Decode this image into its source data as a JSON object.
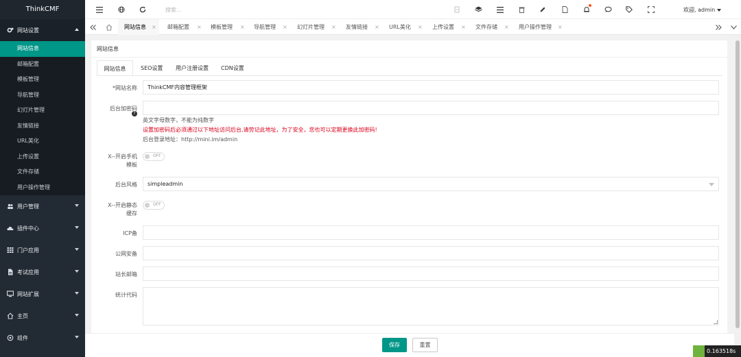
{
  "app": {
    "logo_text": "ThinkCMF"
  },
  "sidebar": {
    "groups": [
      {
        "label": "网站设置",
        "icon": "gears-icon",
        "open": true
      },
      {
        "label": "用户管理",
        "icon": "users-icon"
      },
      {
        "label": "插件中心",
        "icon": "cloud-icon"
      },
      {
        "label": "门户应用",
        "icon": "grid-icon"
      },
      {
        "label": "考试应用",
        "icon": "file-icon"
      },
      {
        "label": "网站扩展",
        "icon": "desktop-icon"
      },
      {
        "label": "主页",
        "icon": "home-icon"
      },
      {
        "label": "组件",
        "icon": "component-icon"
      }
    ],
    "sub_items": [
      "网站信息",
      "邮箱配置",
      "模板管理",
      "导航管理",
      "幻灯片管理",
      "友情链接",
      "URL美化",
      "上传设置",
      "文件存储",
      "用户操作管理"
    ],
    "active_sub": "网站信息"
  },
  "header": {
    "search_placeholder": "搜索...",
    "welcome": "欢迎, admin"
  },
  "tabs": [
    "网站信息",
    "邮箱配置",
    "模板管理",
    "导航管理",
    "幻灯片管理",
    "友情链接",
    "URL美化",
    "上传设置",
    "文件存储",
    "用户操作管理"
  ],
  "panel": {
    "title": "网站信息",
    "form_tabs": [
      "网站信息",
      "SEO设置",
      "用户注册设置",
      "CDN设置"
    ],
    "fields": {
      "site_name_label": "*网站名称",
      "site_name_value": "ThinkCMF内容管理框架",
      "admin_pwd_label": "后台加密码",
      "admin_pwd_hint1": "英文字母数字，不能为纯数字",
      "admin_pwd_hint2": "设置加密码后必须通过以下地址访问后台,请劳记此地址，为了安全，您也可以定期更换此加密码!",
      "admin_pwd_hint3": "后台登录地址：http://mini.im/admin",
      "mobile_tpl_label_1": "X--开启手机",
      "mobile_tpl_label_2": "模板",
      "switch_off": "OFF",
      "admin_style_label": "后台风格",
      "admin_style_value": "simpleadmin",
      "static_cache_label_1": "X--开启静态",
      "static_cache_label_2": "缓存",
      "icp_label": "ICP备",
      "police_label": "公网安备",
      "email_label": "站长邮箱",
      "stats_label": "统计代码"
    },
    "buttons": {
      "save": "保存",
      "reset": "重置"
    }
  },
  "debug_badge": "0.163518s",
  "colors": {
    "accent": "#009688",
    "sidebar_bg": "#222a33",
    "error_text": "#d9001b"
  }
}
